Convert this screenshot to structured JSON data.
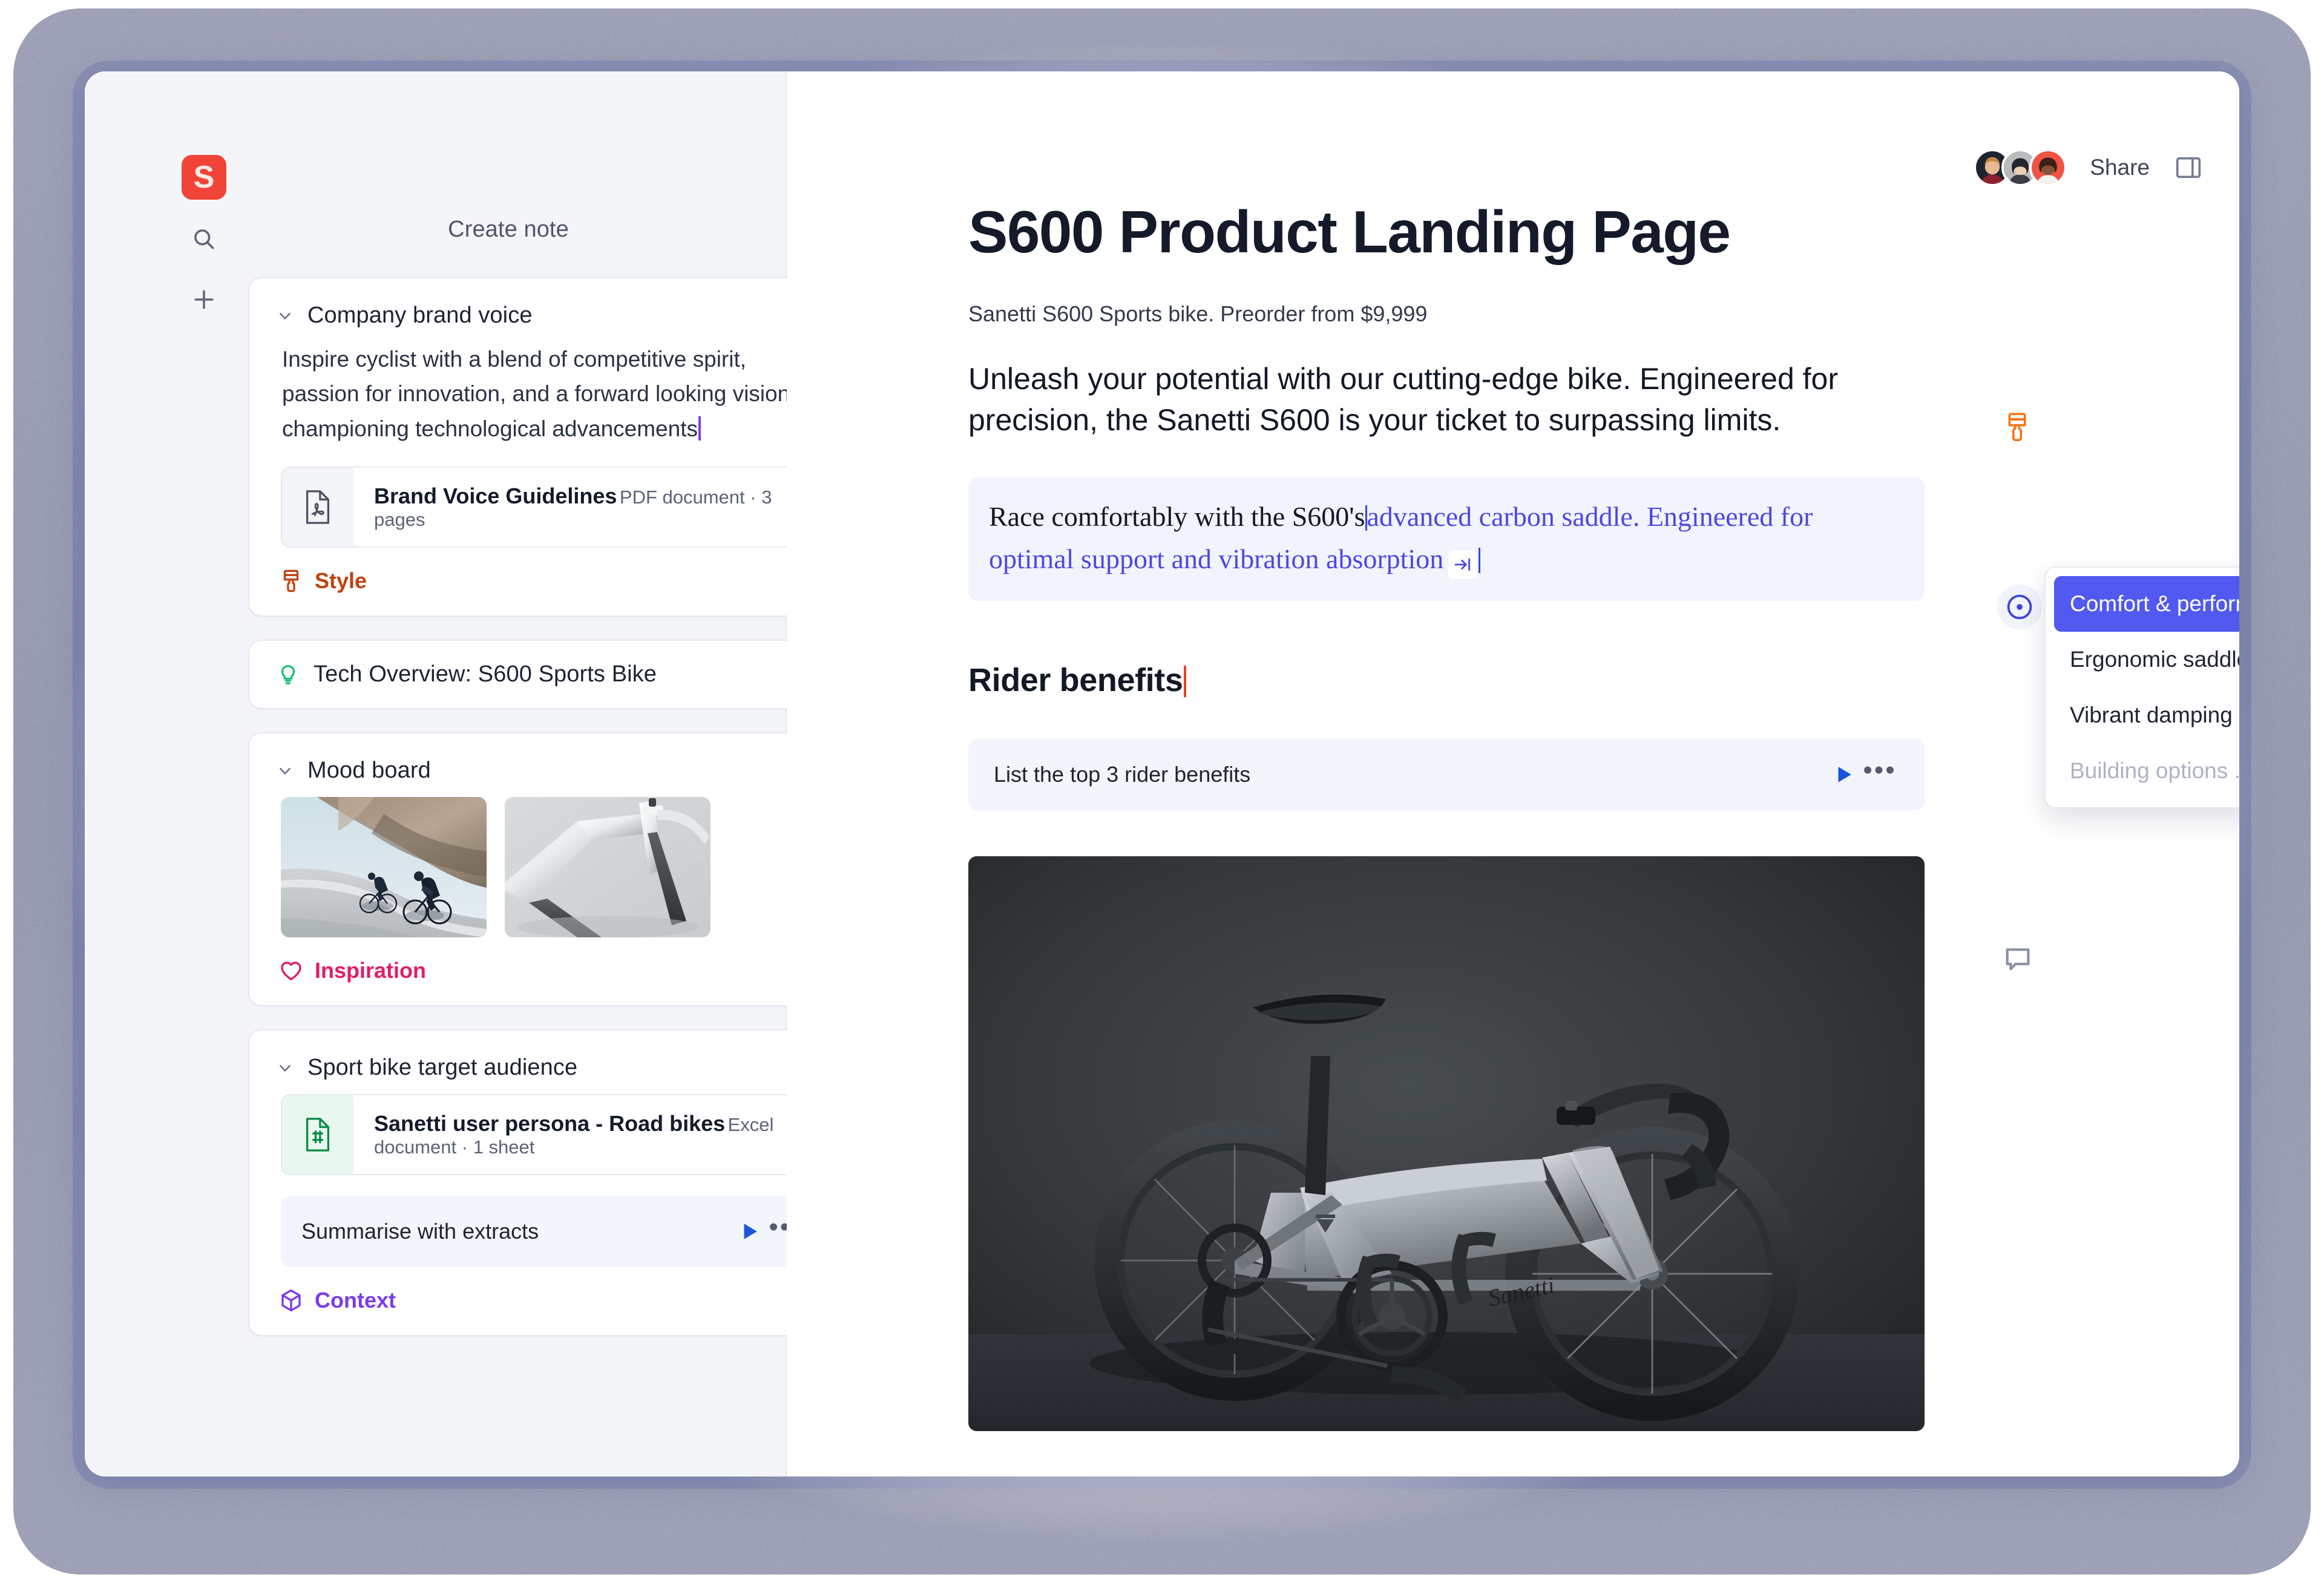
{
  "app": {
    "logo_letter": "S",
    "logo_color": "#f04438"
  },
  "sidebar": {
    "search_icon": "search-icon",
    "add_icon": "plus-icon",
    "create_note_label": "Create note",
    "cards": [
      {
        "title": "Company brand voice",
        "body": "Inspire cyclist with a blend of competitive spirit, passion for innovation, and a forward looking vision championing technological advancements",
        "attachment": {
          "name": "Brand Voice Guidelines",
          "meta": "PDF document · 3 pages",
          "icon": "pdf-file-icon"
        },
        "badge": {
          "label": "Style",
          "icon": "paint-brush-icon",
          "color": "#c2410c"
        }
      },
      {
        "title": "Tech Overview: S600 Sports Bike",
        "icon": "lightbulb-icon"
      },
      {
        "title": "Mood board",
        "images": [
          {
            "alt": "two cyclists riding on mountain road"
          },
          {
            "alt": "close-up of white carbon bike frame"
          }
        ],
        "badge": {
          "label": "Inspiration",
          "icon": "heart-icon",
          "color": "#e11d69"
        }
      },
      {
        "title": "Sport bike target audience",
        "attachment": {
          "name": "Sanetti user persona - Road bikes",
          "meta": "Excel document · 1 sheet",
          "icon": "excel-file-icon"
        },
        "prompt": {
          "text": "Summarise with extracts",
          "run_icon": "play-icon",
          "more_icon": "ellipsis-icon"
        },
        "badge": {
          "label": "Context",
          "icon": "cube-icon",
          "color": "#7c3aed"
        }
      }
    ]
  },
  "topbar": {
    "share_label": "Share",
    "panel_toggle_icon": "split-panel-icon",
    "avatars": [
      {
        "name": "collaborator-1"
      },
      {
        "name": "collaborator-2"
      },
      {
        "name": "collaborator-3"
      }
    ]
  },
  "document": {
    "title": "S600 Product Landing Page",
    "subtitle": "Sanetti S600 Sports bike. Preorder from $9,999",
    "lead": "Unleash your potential with our cutting-edge bike. Engineered for precision, the Sanetti S600 is your ticket to surpassing limits.",
    "highlight": {
      "committed_text": "Race comfortably with the S600's",
      "suggestion_text": "advanced carbon saddle. Engineered for optimal support and vibration absorption",
      "accept_key_icon": "tab-key-icon"
    },
    "brush_marker_icon": "paint-brush-icon",
    "target_icon": "record-dot-icon",
    "comment_icon": "comment-bubble-icon",
    "heading2": "Rider benefits",
    "prompt": {
      "text": "List the top 3 rider benefits",
      "run_icon": "play-icon",
      "more_icon": "ellipsis-icon"
    },
    "hero_image": {
      "alt": "Sanetti S600 grey carbon road bike on dark studio background"
    }
  },
  "suggestion_menu": {
    "items": [
      {
        "label": "Comfort & performance",
        "state": "active",
        "key_icon": "tab-key-icon"
      },
      {
        "label": "Ergonomic saddle",
        "state": "normal"
      },
      {
        "label": "Vibrant damping",
        "state": "normal"
      },
      {
        "label": "Building options ...",
        "state": "loading"
      }
    ]
  },
  "colors": {
    "accent_blue": "#5159f0",
    "suggestion_text": "#4f46e5",
    "brand_red": "#f04438",
    "style_orange": "#c2410c",
    "inspiration_pink": "#e11d69",
    "context_purple": "#7c3aed"
  }
}
